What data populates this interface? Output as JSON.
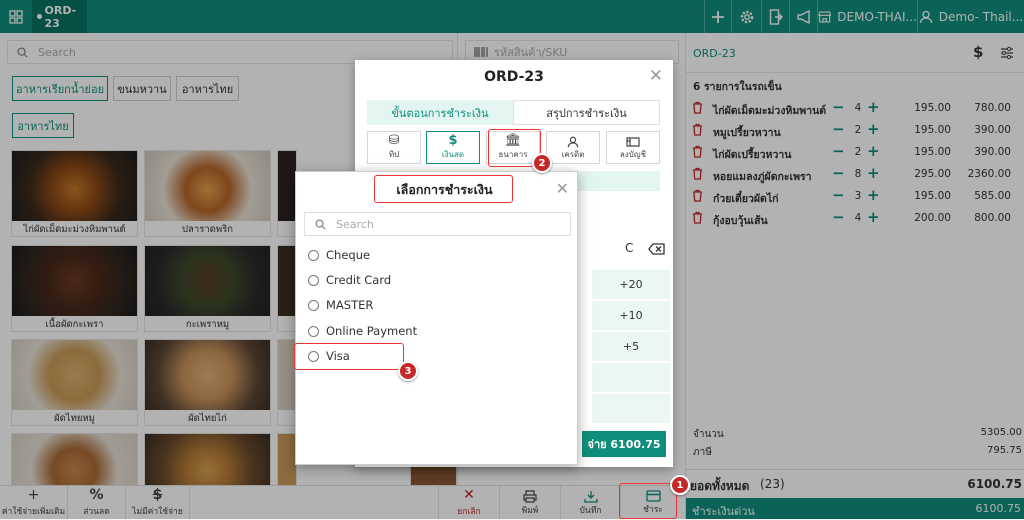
{
  "topbar": {
    "order_tab": "ORD-23",
    "branch": "DEMO-THAI...",
    "user": "Demo- Thail..."
  },
  "left": {
    "search_placeholder": "Search",
    "categories": [
      "อาหารเรียกน้ำย่อย",
      "ขนมหวาน",
      "อาหารไทย",
      "อาหารไทย"
    ],
    "products": [
      "ไก่ผัดเม็ดมะม่วงหิมพานต์",
      "ปลาราดพริก",
      "เนื้อผัดกะเพรา",
      "กะเพราหมู",
      "ผัดไทยหมู",
      "ผัดไทยไก่"
    ]
  },
  "sku": {
    "placeholder": "รหัสสินค้า/SKU"
  },
  "bottom": {
    "add_cost": "ค่าใช้จ่ายเพิ่มเติม",
    "discount": "ส่วนลด",
    "no_cost": "ไม่มีค่าใช้จ่าย",
    "cancel": "ยกเลิก",
    "print": "พิมพ์",
    "save": "บันทึก",
    "pay": "ชำระ"
  },
  "right": {
    "order": "ORD-23",
    "count_label": "6 รายการในรถเข็น",
    "items": [
      {
        "name": "ไก่ผัดเม็ดมะม่วงหิมพานต์",
        "qty": "4",
        "price": "195.00",
        "total": "780.00"
      },
      {
        "name": "หมูเปรี้ยวหวาน",
        "qty": "2",
        "price": "195.00",
        "total": "390.00"
      },
      {
        "name": "ไก่ผัดเปรี้ยวหวาน",
        "qty": "2",
        "price": "195.00",
        "total": "390.00"
      },
      {
        "name": "หอยแมลงภู่ผัดกะเพรา",
        "qty": "8",
        "price": "295.00",
        "total": "2360.00"
      },
      {
        "name": "ก๋วยเตี๋ยวผัดไก่",
        "qty": "3",
        "price": "195.00",
        "total": "585.00"
      },
      {
        "name": "กุ้งอบวุ้นเส้น",
        "qty": "4",
        "price": "200.00",
        "total": "800.00"
      }
    ],
    "subtotal_label": "จำนวน",
    "subtotal": "5305.00",
    "tax_label": "ภาษี",
    "tax": "795.75",
    "grand_label": "ยอดทั้งหมด",
    "grand_count": "(23)",
    "grand": "6100.75",
    "quick_label": "ชำระเงินด่วน",
    "quick": "6100.75"
  },
  "payment_modal": {
    "title": "ORD-23",
    "tab_steps": "ขั้นตอนการชำระเงิน",
    "tab_summary": "สรุปการชำระเงิน",
    "methods": [
      "ทิป",
      "เงินสด",
      "ธนาคาร",
      "เครดิต",
      "ลงบัญชี"
    ],
    "clear": "C",
    "quick": [
      "+20",
      "+10",
      "+5"
    ],
    "pay_button": "จ่าย 6100.75"
  },
  "select_dialog": {
    "title": "เลือกการชำระเงิน",
    "search_placeholder": "Search",
    "options": [
      "Cheque",
      "Credit Card",
      "MASTER",
      "Online Payment",
      "Visa"
    ]
  },
  "steps": [
    "1",
    "2",
    "3"
  ],
  "colors": {
    "accent": "#0f8f7b",
    "danger": "#c52828"
  }
}
